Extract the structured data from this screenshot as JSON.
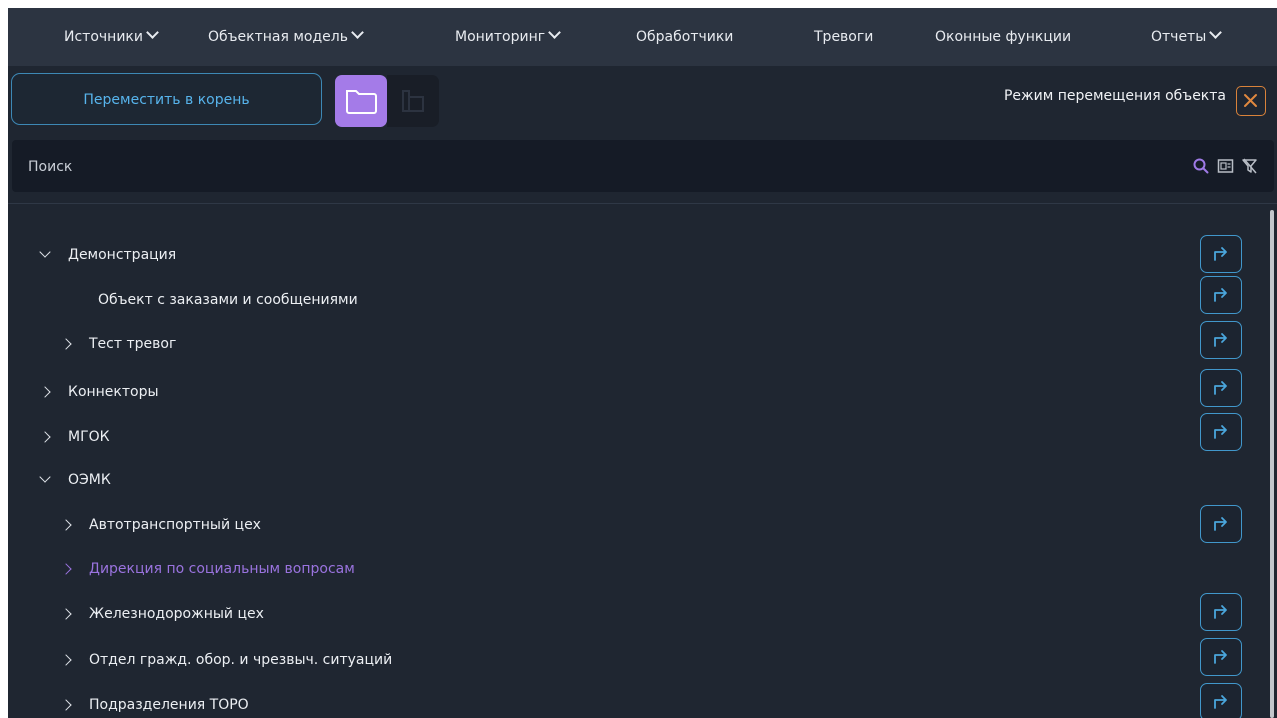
{
  "menu": {
    "sources": "Источники",
    "object_model": "Объектная модель",
    "monitoring": "Мониторинг",
    "handlers": "Обработчики",
    "alarms": "Тревоги",
    "window_functions": "Оконные функции",
    "reports": "Отчеты"
  },
  "toolbar": {
    "move_to_root": "Переместить в корень",
    "mode_label": "Режим перемещения объекта",
    "folder_mode_icon": "folder-icon",
    "object_mode_icon": "object-icon",
    "close_icon": "close-icon"
  },
  "search": {
    "placeholder": "Поиск"
  },
  "tree": {
    "demo": "Демонстрация",
    "demo_orders": "Объект с заказами и сообщениями",
    "demo_alarm_test": "Тест тревог",
    "connectors": "Коннекторы",
    "mgok": "МГОК",
    "oemk": "ОЭМК",
    "oemk_transport": "Автотранспортный цех",
    "oemk_social": "Дирекция по социальным вопросам",
    "oemk_railway": "Железнодорожный цех",
    "oemk_civil_defense": "Отдел гражд. обор. и чрезвыч. ситуаций",
    "oemk_toro": "Подразделения ТОРО"
  },
  "colors": {
    "background": "#1f2631",
    "menubar": "#2c3441",
    "accent_blue": "#57b4ec",
    "accent_purple": "#a47be8",
    "close_orange": "#d9823a"
  }
}
